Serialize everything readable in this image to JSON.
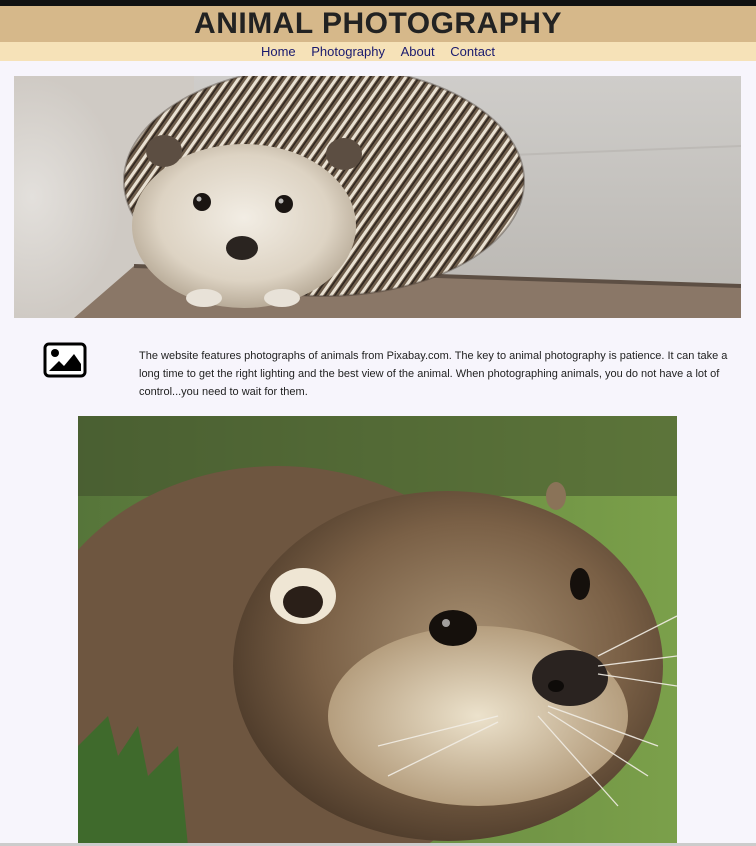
{
  "site": {
    "title": "ANIMAL PHOTOGRAPHY"
  },
  "nav": {
    "items": [
      {
        "label": "Home"
      },
      {
        "label": "Photography"
      },
      {
        "label": "About"
      },
      {
        "label": "Contact"
      }
    ]
  },
  "hero": {
    "subject": "hedgehog"
  },
  "intro": {
    "icon": "image-icon",
    "text": "The website features photographs of animals from Pixabay.com. The key to animal photography is patience. It can take a long time to get the right lighting and the best view of the animal. When photographing animals, you do not have a lot of control...you need to wait for them."
  },
  "feature": {
    "subject": "otter"
  },
  "colors": {
    "header_bg": "#d6b88a",
    "nav_bg": "#f6e2b8",
    "nav_link": "#1a1a6e",
    "page_bg": "#f7f5fc"
  }
}
